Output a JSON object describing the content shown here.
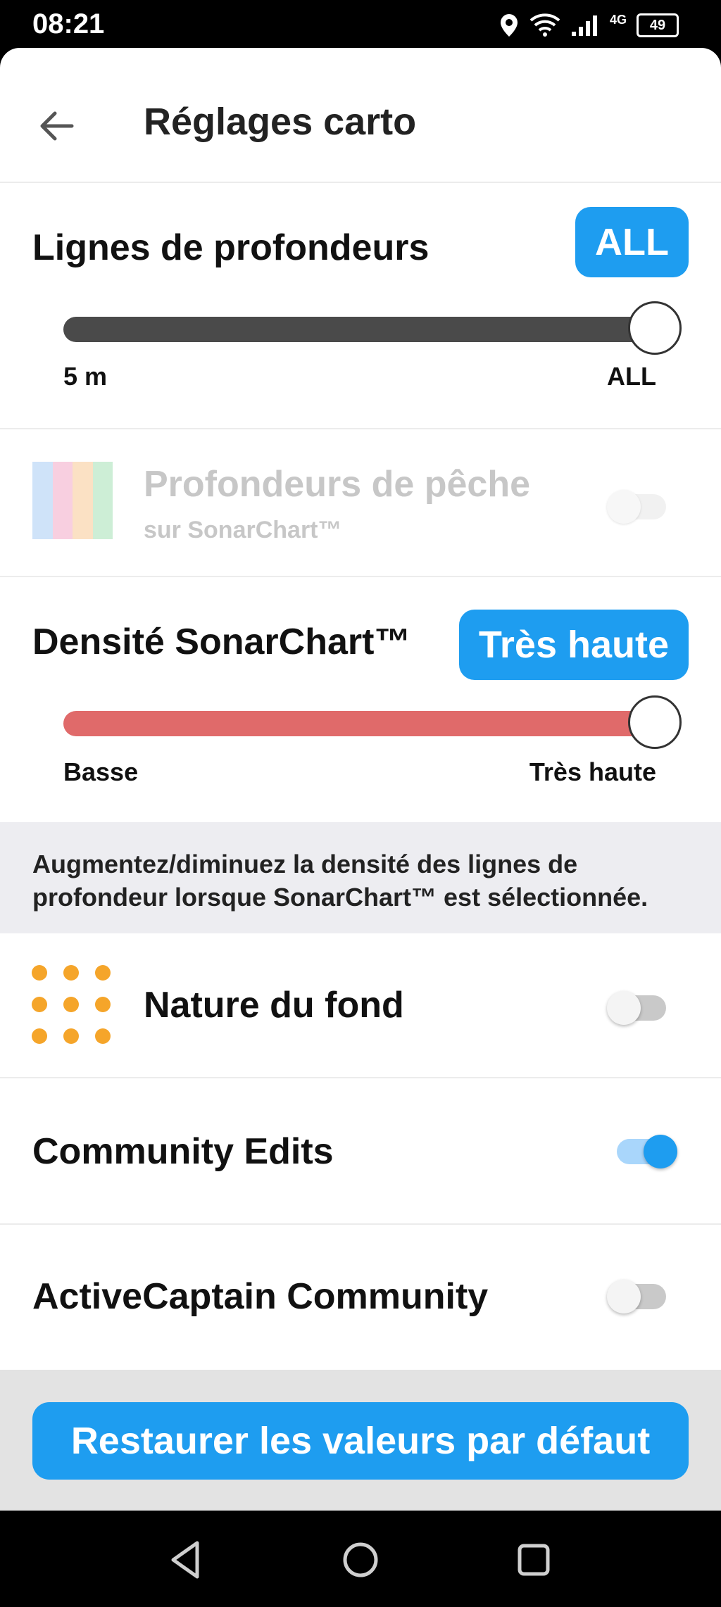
{
  "status_bar": {
    "time": "08:21",
    "network": "4G",
    "battery": "49"
  },
  "header": {
    "title": "Réglages carto"
  },
  "depth_lines": {
    "title": "Lignes de profondeurs",
    "badge": "ALL",
    "min_label": "5 m",
    "max_label": "ALL",
    "slider_value": 1.0
  },
  "fishing_depth": {
    "title": "Profondeurs de pêche",
    "subtitle": "sur SonarChart™",
    "enabled": false,
    "toggle_disabled": true,
    "swatch_colors": [
      "#cfe3f9",
      "#f8cfe0",
      "#fbe1c4",
      "#cdeed6"
    ]
  },
  "sonar_density": {
    "title": "Densité SonarChart™",
    "badge": "Très haute",
    "min_label": "Basse",
    "max_label": "Très haute",
    "slider_value": 1.0
  },
  "info": {
    "text": "Augmentez/diminuez la densité des lignes de profondeur lorsque SonarChart™ est sélectionnée."
  },
  "bottom_nature": {
    "label": "Nature du fond",
    "enabled": false
  },
  "community_edits": {
    "label": "Community Edits",
    "enabled": true
  },
  "activecaptain": {
    "label": "ActiveCaptain Community",
    "enabled": false
  },
  "restore": {
    "label": "Restaurer les valeurs par défaut"
  },
  "colors": {
    "accent": "#1e9df0",
    "depth_track": "#4a4a4a",
    "density_track": "#e06a6a",
    "dots": "#f5a52a"
  }
}
